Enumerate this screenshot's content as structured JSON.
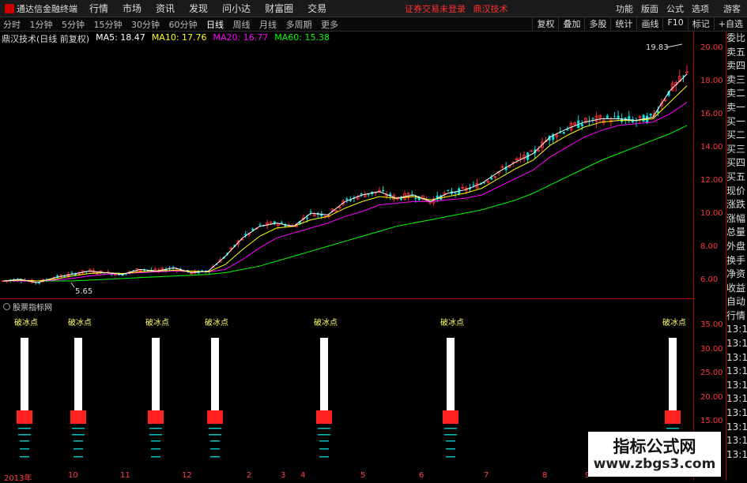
{
  "app": {
    "title": "通达信金融终端"
  },
  "menu": [
    "行情",
    "市场",
    "资讯",
    "发现",
    "问小达",
    "财富圈",
    "交易"
  ],
  "status_text": "证券交易未登录",
  "status_stock": "鼎汉技术",
  "right_menu": [
    "功能",
    "版面",
    "公式",
    "选项"
  ],
  "guest_label": "游客",
  "periods": [
    "分时",
    "1分钟",
    "5分钟",
    "15分钟",
    "30分钟",
    "60分钟",
    "日线",
    "周线",
    "月线",
    "多周期",
    "更多"
  ],
  "active_period": "日线",
  "right_tools": [
    "复权",
    "叠加",
    "多股",
    "统计",
    "画线",
    "F10",
    "标记",
    "+自选"
  ],
  "chart_title": "鼎汉技术(日线 前复权)",
  "ma_labels": [
    {
      "text": "MA5: 18.47",
      "color": "#ffffff"
    },
    {
      "text": "MA10: 17.76",
      "color": "#ffff00"
    },
    {
      "text": "MA20: 16.77",
      "color": "#ff00ff"
    },
    {
      "text": "MA60: 15.38",
      "color": "#00ff00"
    }
  ],
  "price_axis": [
    "20.00",
    "18.00",
    "16.00",
    "14.00",
    "12.00",
    "10.00",
    "8.00",
    "6.00"
  ],
  "indicator_axis": [
    "35.00",
    "30.00",
    "25.00",
    "20.00",
    "15.00"
  ],
  "indicator_title": "股票指标网",
  "signal_label": "破冰点",
  "high_marker": "19.83",
  "low_marker": "5.65",
  "right_panel": [
    "委比",
    "卖五",
    "卖四",
    "卖三",
    "卖二",
    "卖一",
    "买一",
    "买二",
    "买三",
    "买四",
    "买五",
    "现价",
    "涨跌",
    "涨幅",
    "总量",
    "外盘",
    "换手",
    "净资",
    "收益",
    "自动",
    "行情",
    "13:1",
    "13:1",
    "13:1",
    "13:1",
    "13:1",
    "13:1",
    "13:1",
    "13:1",
    "13:1",
    "13:1"
  ],
  "dates": [
    "2013年",
    "10",
    "11",
    "12",
    "2",
    "3",
    "4",
    "5",
    "6",
    "7",
    "8",
    "9"
  ],
  "watermark": {
    "line1": "指标公式网",
    "line2": "www.zbgs3.com"
  },
  "chart_data": {
    "type": "line",
    "yrange": [
      5.0,
      20.5
    ],
    "ma5": [
      6.0,
      6.1,
      5.9,
      6.2,
      6.4,
      6.6,
      6.5,
      6.4,
      6.7,
      6.6,
      6.8,
      6.5,
      6.6,
      7.5,
      8.6,
      9.3,
      9.5,
      9.3,
      10.1,
      10.0,
      10.8,
      11.2,
      11.4,
      11.0,
      11.2,
      10.8,
      11.3,
      11.5,
      11.9,
      12.6,
      13.2,
      13.7,
      14.7,
      15.2,
      15.6,
      15.8,
      15.8,
      15.7,
      15.9,
      17.5,
      18.5
    ],
    "ma10": [
      6.0,
      6.05,
      6.0,
      6.1,
      6.3,
      6.45,
      6.5,
      6.45,
      6.55,
      6.6,
      6.65,
      6.6,
      6.55,
      7.0,
      7.9,
      8.7,
      9.2,
      9.3,
      9.7,
      9.9,
      10.4,
      10.8,
      11.1,
      11.0,
      11.1,
      10.9,
      11.1,
      11.3,
      11.6,
      12.2,
      12.8,
      13.3,
      14.2,
      14.8,
      15.3,
      15.6,
      15.7,
      15.7,
      15.8,
      16.8,
      17.8
    ],
    "ma20": [
      6.0,
      6.0,
      6.0,
      6.05,
      6.15,
      6.3,
      6.4,
      6.45,
      6.5,
      6.55,
      6.6,
      6.6,
      6.55,
      6.7,
      7.3,
      8.0,
      8.6,
      8.9,
      9.2,
      9.5,
      9.9,
      10.2,
      10.6,
      10.7,
      10.8,
      10.8,
      10.9,
      11.0,
      11.2,
      11.7,
      12.2,
      12.7,
      13.5,
      14.1,
      14.7,
      15.1,
      15.4,
      15.5,
      15.6,
      16.1,
      16.8
    ],
    "ma60": [
      6.0,
      6.0,
      6.0,
      6.0,
      6.0,
      6.05,
      6.1,
      6.15,
      6.2,
      6.25,
      6.3,
      6.35,
      6.4,
      6.5,
      6.7,
      6.9,
      7.2,
      7.5,
      7.8,
      8.1,
      8.4,
      8.7,
      9.0,
      9.3,
      9.5,
      9.7,
      9.9,
      10.1,
      10.3,
      10.6,
      10.9,
      11.3,
      11.8,
      12.3,
      12.8,
      13.3,
      13.7,
      14.1,
      14.5,
      14.9,
      15.4
    ],
    "signals_x_fraction": [
      0.035,
      0.113,
      0.225,
      0.31,
      0.467,
      0.65,
      0.97
    ]
  }
}
